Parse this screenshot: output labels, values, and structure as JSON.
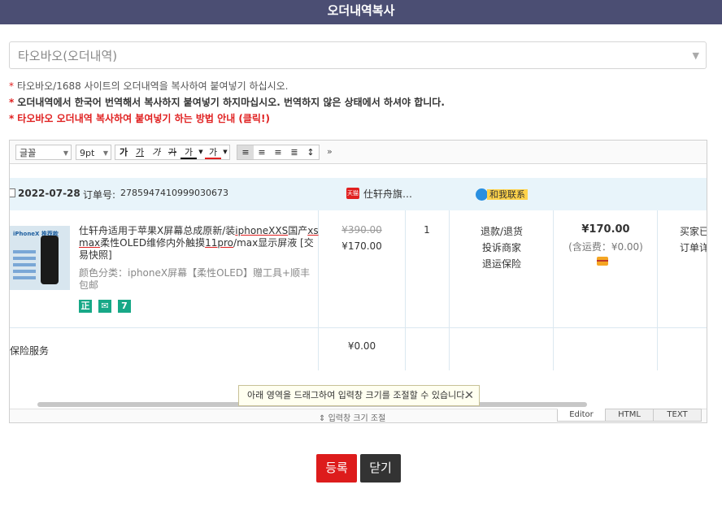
{
  "header": {
    "title": "오더내역복사"
  },
  "source_select": {
    "value": "타오바오(오더내역)"
  },
  "notes": [
    "타오바오/1688 사이트의 오더내역을 복사하여 붙여넣기 하십시오.",
    "오더내역에서 한국어 번역해서 복사하지 붙여넣기 하지마십시오. 번역하지 않은 상태에서 하셔야 합니다.",
    "타오바오 오더내역 복사하여 붙여넣기 하는 방법 안내 (클릭!)"
  ],
  "toolbar": {
    "font": "글꼴",
    "size": "9pt",
    "bold": "가",
    "underline": "가",
    "italic": "가",
    "strike": "가",
    "color": "가",
    "highlight": "가",
    "more": "»"
  },
  "order": {
    "date": "2022-07-28",
    "order_label": "订单号:",
    "order_number": "2785947410999030673",
    "shop_name": "仕轩舟旗…",
    "contact_label": "和我联系",
    "product": {
      "title_a": "仕轩舟适用于苹果X屏幕总成原新/装",
      "title_b": "iphoneXXS",
      "title_c": "国产",
      "title_d": "xs max",
      "title_e": "柔性OLED维修内外触摸",
      "title_f": "11pro",
      "title_g": "/max显示屏液 [交易快照]",
      "spec": "颜色分类：iphoneX屏幕【柔性OLED】赠工具+顺丰包邮",
      "badges": [
        "正",
        "✉",
        "7"
      ],
      "thumb_text": "iPhoneX 推荐款"
    },
    "price_original": "¥390.00",
    "price_now": "¥170.00",
    "quantity": "1",
    "services": [
      "退款/退货",
      "投诉商家",
      "退运保险"
    ],
    "total": "¥170.00",
    "shipping": "(含运费：¥0.00)",
    "buyer_lines": [
      "买家已",
      "订单详"
    ],
    "insurance_label": "保险服务",
    "insurance_value": "¥0.00"
  },
  "editor": {
    "tooltip": "아래 영역을 드래그하여 입력창 크기를 조절할 수 있습니다.",
    "resize_label": "입력창 크기 조절",
    "tabs": [
      "Editor",
      "HTML",
      "TEXT"
    ],
    "active_tab": "Editor"
  },
  "buttons": {
    "register": "등록",
    "close": "닫기"
  }
}
